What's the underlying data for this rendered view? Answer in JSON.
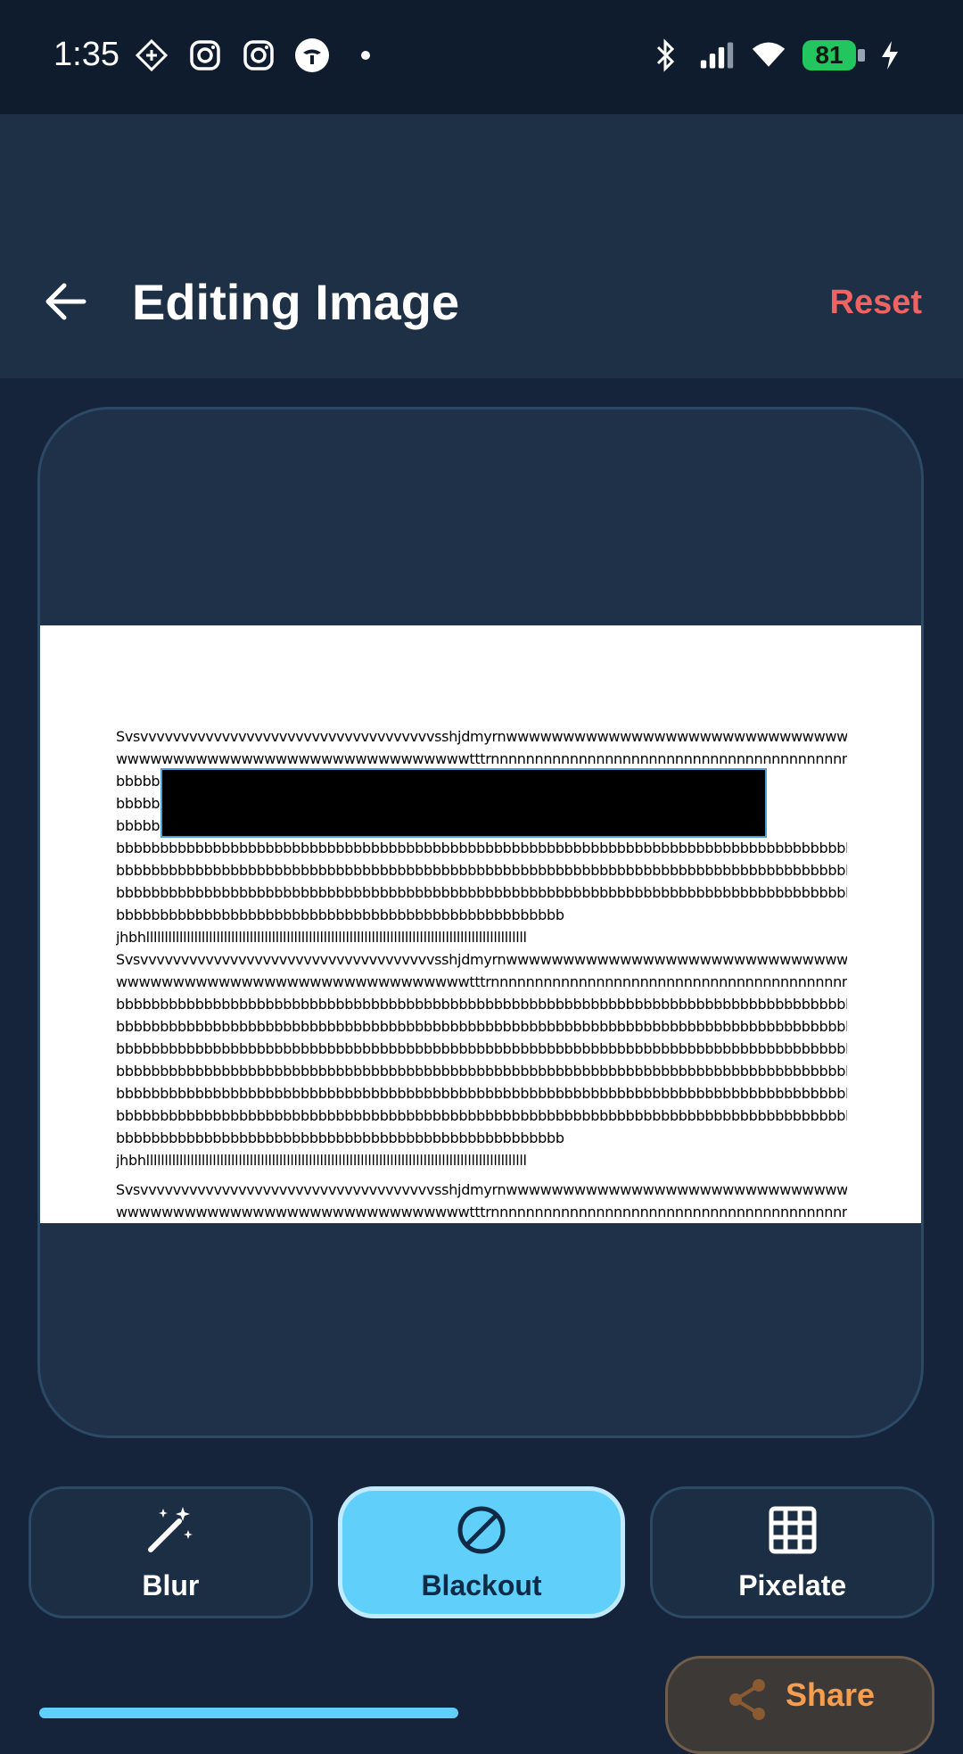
{
  "status_bar": {
    "time": "1:35",
    "battery": "81",
    "left_icons": [
      "navigation-diamond-icon",
      "instagram-icon",
      "instagram-icon",
      "app-icon",
      "dot-icon"
    ],
    "right_icons": [
      "bluetooth-icon",
      "signal-icon",
      "wifi-icon",
      "battery-icon",
      "charging-icon"
    ]
  },
  "header": {
    "title": "Editing Image",
    "reset_label": "Reset"
  },
  "document": {
    "lines": [
      "Svsvvvvvvvvvvvvvvvvvvvvvvvvvvvvvvvvvvvvsshjdmyrnwwwwwwwwwwwwwwwwwwwwwwwwwwwwwwwwwwwwwwwww",
      "wwwwwwwwwwwwwwwwwwwwwwwwwwwwwwwtttrnnnnnnnnnnnnnnnnnnnnnnnnnnnnnnnnnnnnnnnnnnnnnnaebbbbbbbb",
      "bbbbb",
      "bbbbb",
      "bbbbb",
      "bbbbbbbbbbbbbbbbbbbbbbbbbbbbbbbbbbbbbbbbbbbbbbbbbbbbbbbbbbbbbbbbbbbbbbbbbbbbbbbbbbbbbbbbb",
      "bbbbbbbbbbbbbbbbbbbbbbbbbbbbbbbbbbbbbbbbbbbbbbbbbbbbbbbbbbbbbbbbbbbbbbbbbbbbbbbbbbbbbbbbbb",
      "bbbbbbbbbbbbbbbbbbbbbbbbbbbbbbbbbbbbbbbbbbbbbbbbbbbbbbbbbbbbbbbbbbbbbbbbbbbbbbbbbbbbbbbbbb",
      "bbbbbbbbbbbbbbbbbbbbbbbbbbbbbbbbbbbbbbbbbbbbbbbbbbb",
      "jhbhlllllllllllllllllllllllllllllllllllllllllllllllllllllllllllllllllllllllllllllllllllllllllllllllllllllll",
      "Svsvvvvvvvvvvvvvvvvvvvvvvvvvvvvvvvvvvvvsshjdmyrnwwwwwwwwwwwwwwwwwwwwwwwwwwwwwwwwwwwwwwwww",
      "wwwwwwwwwwwwwwwwwwwwwwwwwwwwwwwtttrnnnnnnnnnnnnnnnnnnnnnnnnnnnnnnnnnnnnnnnnnnnnnnaebbbbbbbb",
      "bbbbbbbbbbbbbbbbbbbbbbbbbbbbbbbbbbbbbbbbbbbbbbbbbbbbbbbbbbbbbbbbbbbbbbbbbbbbbbbbbbbbbbbbbb",
      "bbbbbbbbbbbbbbbbbbbbbbbbbbbbbbbbbbbbbbbbbbbbbbbbbbbbbbbbbbbbbbbbbbbbbbbbbbbbbbbbbbbbbbbbbb",
      "bbbbbbbbbbbbbbbbbbbbbbbbbbbbbbbbbbbbbbbbbbbbbbbbbbbbbbbbbbbbbbbbbbbbbbbbbbbbbbbbbbbbbbbbbb",
      "bbbbbbbbbbbbbbbbbbbbbbbbbbbbbbbbbbbbbbbbbbbbbbbbbbbbbbbbbbbbbbbbbbbbbbbbbbbbbbbbbbbbbbbbbb",
      "bbbbbbbbbbbbbbbbbbbbbbbbbbbbbbbbbbbbbbbbbbbbbbbbbbbbbbbbbbbbbbbbbbbbbbbbbbbbbbbbbbbbbbbbbb",
      "bbbbbbbbbbbbbbbbbbbbbbbbbbbbbbbbbbbbbbbbbbbbbbbbbbbbbbbbbbbbbbbbbbbbbbbbbbbbbbbbbbbbbbbbbb",
      "bbbbbbbbbbbbbbbbbbbbbbbbbbbbbbbbbbbbbbbbbbbbbbbbbbb",
      "jhbhlllllllllllllllllllllllllllllllllllllllllllllllllllllllllllllllllllllllllllllllllllllllllllllllllllllll",
      "",
      "Svsvvvvvvvvvvvvvvvvvvvvvvvvvvvvvvvvvvvvsshjdmyrnwwwwwwwwwwwwwwwwwwwwwwwwwwwwwwwwwwwwwwwww",
      "wwwwwwwwwwwwwwwwwwwwwwwwwwwwwwwtttrnnnnnnnnnnnnnnnnnnnnnnnnnnnnnnnnnnnnnnnnnnnnnnnaebbbbbbbb"
    ]
  },
  "tools": [
    {
      "label": "Blur",
      "icon": "magic-wand-icon"
    },
    {
      "label": "Blackout",
      "icon": "prohibit-icon",
      "active": true
    },
    {
      "label": "Pixelate",
      "icon": "grid-icon"
    }
  ],
  "share": {
    "label": "Share"
  },
  "colors": {
    "accent": "#60cff9",
    "reset": "#f06363",
    "share": "#f59e50",
    "background": "#15243a"
  }
}
